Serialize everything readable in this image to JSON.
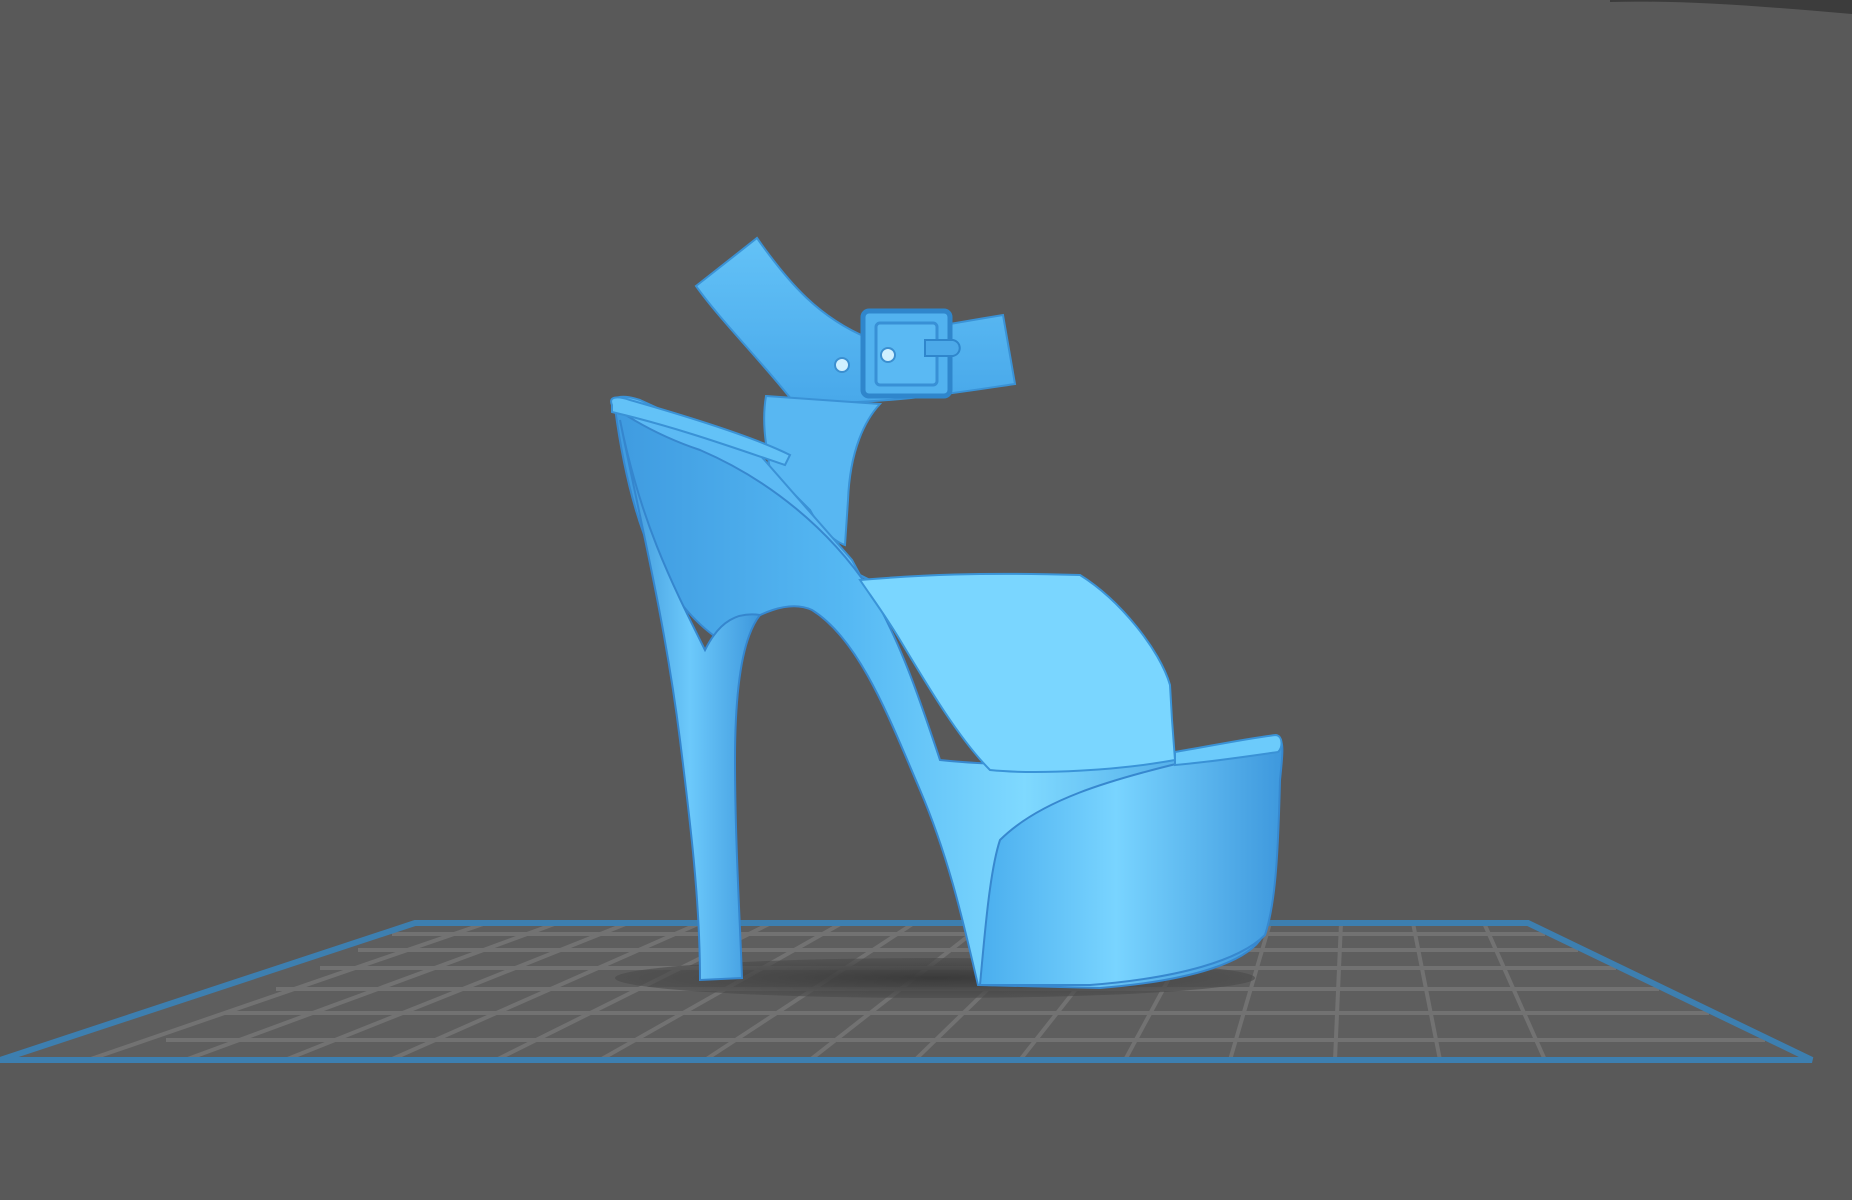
{
  "viewport": {
    "background_color": "#595959",
    "model": {
      "name": "",
      "object_type": "platform-high-heel-sandal",
      "color": "#4fb3f2"
    },
    "build_plate": {
      "outline_color": "#3d7fb0",
      "grid_color": "#707070"
    }
  }
}
